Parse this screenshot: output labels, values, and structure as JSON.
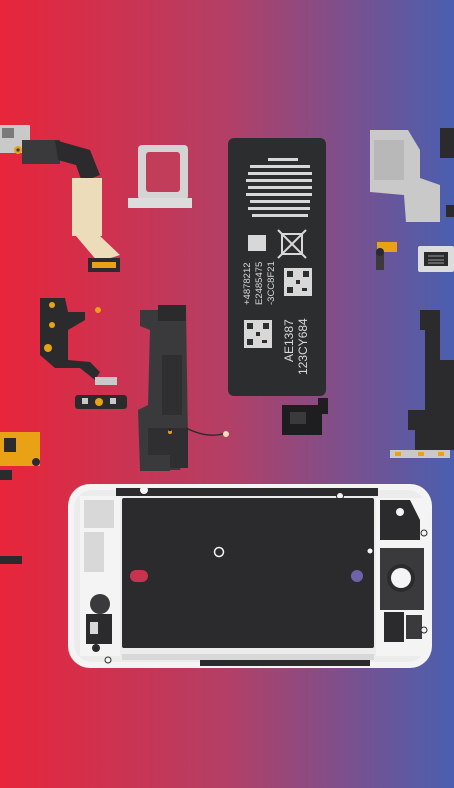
{
  "image": {
    "description_tag": "exploded-phone-parts-illustration",
    "background_gradient": [
      "#e8253a",
      "#b33f66",
      "#4a5fb0"
    ]
  },
  "battery": {
    "codes_small": [
      "+4878212",
      "E2485475",
      "-3CC8F21"
    ],
    "code_line_1": "AE1387",
    "code_line_2": "123CY684",
    "color": "#2c2d2f",
    "label_color": "#d8d8d8"
  },
  "colors": {
    "frame": "#f4f4f4",
    "board": "#2b2b2d",
    "dark_part": "#3a3a3c",
    "flex_tan": "#ecdcb9",
    "gold": "#e9a116",
    "steel": "#c9c9c9",
    "accent_red": "#c8334f",
    "accent_purple": "#6d63a8"
  }
}
